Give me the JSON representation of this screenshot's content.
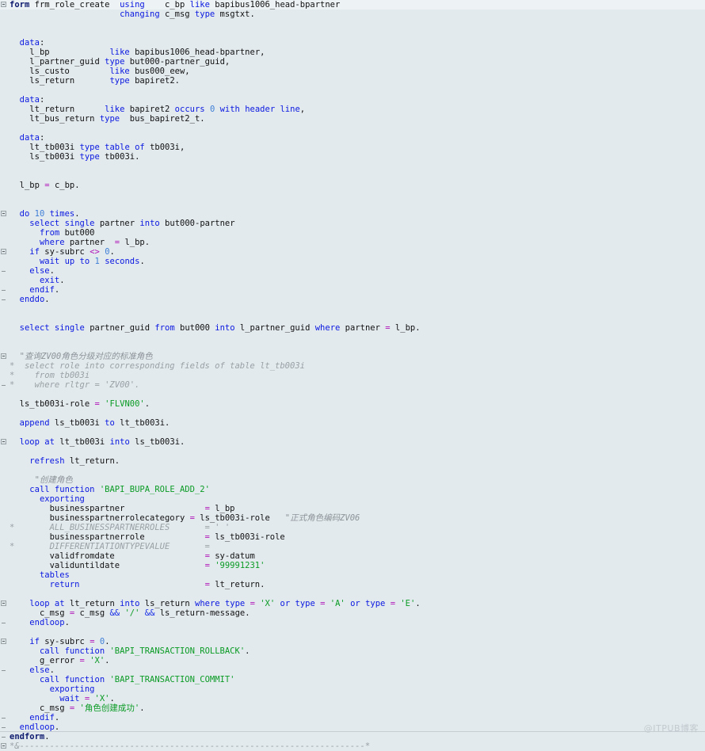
{
  "editor": {
    "background_color": "#e3eaee",
    "first_line_highlight_color": "#edf2f5",
    "font": "monospace",
    "watermark": "@ITPUB博客",
    "language": "ABAP",
    "colors": {
      "keyword": "#0a18e0",
      "form_keyword": "#0d1a6e",
      "number": "#3f7fd6",
      "string": "#0a9b24",
      "operator": "#b015b8",
      "comment": "#8d9499",
      "plain_text": "#111111"
    }
  },
  "lines": [
    {
      "gutter": "box",
      "text": "form frm_role_create  using    c_bp like bapibus1006_head-bpartner"
    },
    {
      "gutter": "",
      "text": "                      changing c_msg type msgtxt."
    },
    {
      "gutter": "",
      "text": ""
    },
    {
      "gutter": "",
      "text": ""
    },
    {
      "gutter": "",
      "text": "  data:"
    },
    {
      "gutter": "",
      "text": "    l_bp            like bapibus1006_head-bpartner,"
    },
    {
      "gutter": "",
      "text": "    l_partner_guid type but000-partner_guid,"
    },
    {
      "gutter": "",
      "text": "    ls_custo        like bus000_eew,"
    },
    {
      "gutter": "",
      "text": "    ls_return       type bapiret2."
    },
    {
      "gutter": "",
      "text": ""
    },
    {
      "gutter": "",
      "text": "  data:"
    },
    {
      "gutter": "",
      "text": "    lt_return      like bapiret2 occurs 0 with header line,"
    },
    {
      "gutter": "",
      "text": "    lt_bus_return type  bus_bapiret2_t."
    },
    {
      "gutter": "",
      "text": ""
    },
    {
      "gutter": "",
      "text": "  data:"
    },
    {
      "gutter": "",
      "text": "    lt_tb003i type table of tb003i,"
    },
    {
      "gutter": "",
      "text": "    ls_tb003i type tb003i."
    },
    {
      "gutter": "",
      "text": ""
    },
    {
      "gutter": "",
      "text": ""
    },
    {
      "gutter": "",
      "text": "  l_bp = c_bp."
    },
    {
      "gutter": "",
      "text": ""
    },
    {
      "gutter": "",
      "text": ""
    },
    {
      "gutter": "box",
      "text": "  do 10 times."
    },
    {
      "gutter": "",
      "text": "    select single partner into but000-partner"
    },
    {
      "gutter": "",
      "text": "      from but000"
    },
    {
      "gutter": "",
      "text": "      where partner  = l_bp."
    },
    {
      "gutter": "box",
      "text": "    if sy-subrc <> 0."
    },
    {
      "gutter": "",
      "text": "      wait up to 1 seconds."
    },
    {
      "gutter": "dash",
      "text": "    else."
    },
    {
      "gutter": "",
      "text": "      exit."
    },
    {
      "gutter": "dash",
      "text": "    endif."
    },
    {
      "gutter": "dash",
      "text": "  enddo."
    },
    {
      "gutter": "",
      "text": ""
    },
    {
      "gutter": "",
      "text": ""
    },
    {
      "gutter": "",
      "text": "  select single partner_guid from but000 into l_partner_guid where partner = l_bp."
    },
    {
      "gutter": "",
      "text": ""
    },
    {
      "gutter": "",
      "text": ""
    },
    {
      "gutter": "box",
      "text": "  \"查询ZV00角色分级对应的标准角色"
    },
    {
      "gutter": "",
      "text": "*  select role into corresponding fields of table lt_tb003i"
    },
    {
      "gutter": "",
      "text": "*    from tb003i"
    },
    {
      "gutter": "dash",
      "text": "*    where rltgr = 'ZV00'."
    },
    {
      "gutter": "",
      "text": ""
    },
    {
      "gutter": "",
      "text": "  ls_tb003i-role = 'FLVN00'."
    },
    {
      "gutter": "",
      "text": ""
    },
    {
      "gutter": "",
      "text": "  append ls_tb003i to lt_tb003i."
    },
    {
      "gutter": "",
      "text": ""
    },
    {
      "gutter": "box",
      "text": "  loop at lt_tb003i into ls_tb003i."
    },
    {
      "gutter": "",
      "text": ""
    },
    {
      "gutter": "",
      "text": "    refresh lt_return."
    },
    {
      "gutter": "",
      "text": ""
    },
    {
      "gutter": "",
      "text": "     \"创建角色"
    },
    {
      "gutter": "",
      "text": "    call function 'BAPI_BUPA_ROLE_ADD_2'"
    },
    {
      "gutter": "",
      "text": "      exporting"
    },
    {
      "gutter": "",
      "text": "        businesspartner                = l_bp"
    },
    {
      "gutter": "",
      "text": "        businesspartnerrolecategory = ls_tb003i-role   \"正式角色编码ZV06"
    },
    {
      "gutter": "",
      "text": "*       ALL_BUSINESSPARTNERROLES       = ' '"
    },
    {
      "gutter": "",
      "text": "        businesspartnerrole            = ls_tb003i-role"
    },
    {
      "gutter": "",
      "text": "*       DIFFERENTIATIONTYPEVALUE       ="
    },
    {
      "gutter": "",
      "text": "        validfromdate                  = sy-datum"
    },
    {
      "gutter": "",
      "text": "        validuntildate                 = '99991231'"
    },
    {
      "gutter": "",
      "text": "      tables"
    },
    {
      "gutter": "",
      "text": "        return                         = lt_return."
    },
    {
      "gutter": "",
      "text": ""
    },
    {
      "gutter": "box",
      "text": "    loop at lt_return into ls_return where type = 'X' or type = 'A' or type = 'E'."
    },
    {
      "gutter": "",
      "text": "      c_msg = c_msg && '/' && ls_return-message."
    },
    {
      "gutter": "dash",
      "text": "    endloop."
    },
    {
      "gutter": "",
      "text": ""
    },
    {
      "gutter": "box",
      "text": "    if sy-subrc = 0."
    },
    {
      "gutter": "",
      "text": "      call function 'BAPI_TRANSACTION_ROLLBACK'."
    },
    {
      "gutter": "",
      "text": "      g_error = 'X'."
    },
    {
      "gutter": "dash",
      "text": "    else."
    },
    {
      "gutter": "",
      "text": "      call function 'BAPI_TRANSACTION_COMMIT'"
    },
    {
      "gutter": "",
      "text": "        exporting"
    },
    {
      "gutter": "",
      "text": "          wait = 'X'."
    },
    {
      "gutter": "",
      "text": "      c_msg = '角色创建成功'."
    },
    {
      "gutter": "dash",
      "text": "    endif."
    },
    {
      "gutter": "dash",
      "text": "  endloop."
    },
    {
      "gutter": "dash",
      "text": "endform."
    },
    {
      "gutter": "box",
      "text": "*&---------------------------------------------------------------------*"
    }
  ]
}
